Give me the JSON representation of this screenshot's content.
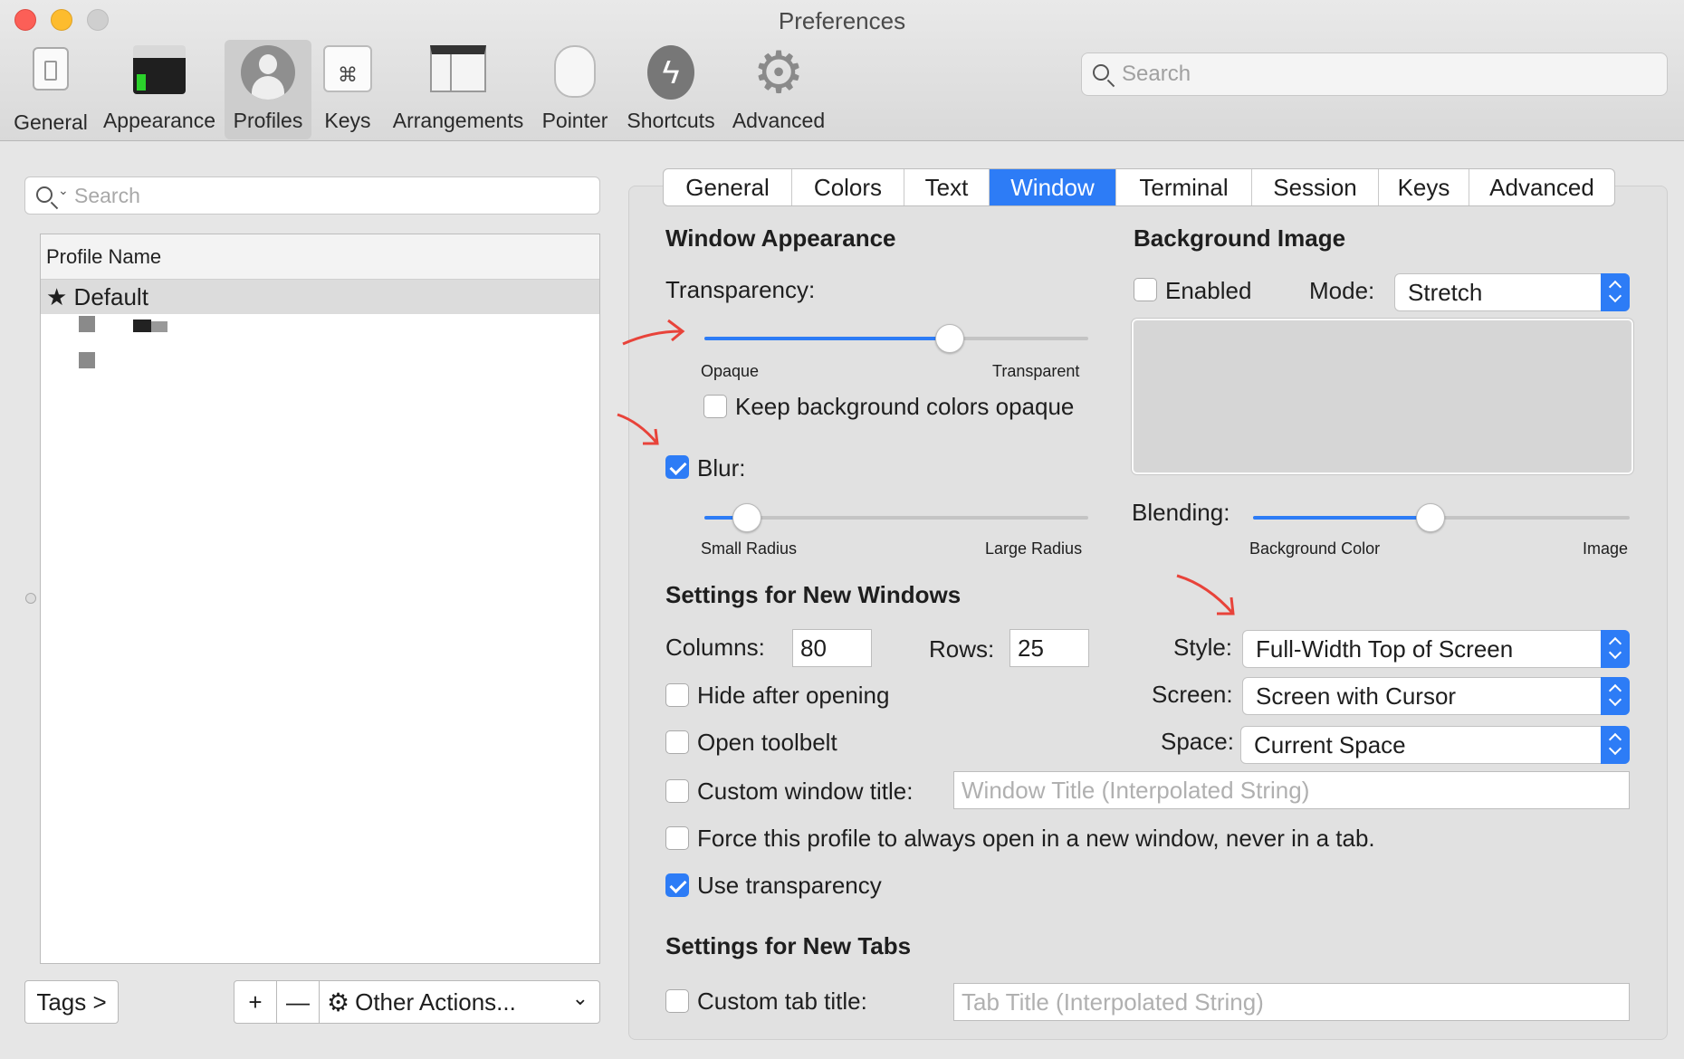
{
  "window": {
    "title": "Preferences"
  },
  "toolbar": {
    "items": [
      {
        "label": "General",
        "icon": "general-switch-icon"
      },
      {
        "label": "Appearance",
        "icon": "appearance-terminal-icon"
      },
      {
        "label": "Profiles",
        "icon": "profile-person-icon",
        "selected": true
      },
      {
        "label": "Keys",
        "icon": "command-key-icon"
      },
      {
        "label": "Arrangements",
        "icon": "arrangements-window-icon"
      },
      {
        "label": "Pointer",
        "icon": "mouse-pointer-icon"
      },
      {
        "label": "Shortcuts",
        "icon": "lightning-bolt-icon"
      },
      {
        "label": "Advanced",
        "icon": "gear-icon"
      }
    ],
    "search_placeholder": "Search"
  },
  "left_panel": {
    "search_placeholder": "Search",
    "column_header": "Profile Name",
    "default_profile": "Default",
    "tags_button": "Tags >",
    "add_symbol": "+",
    "remove_symbol": "—",
    "other_actions": "Other Actions..."
  },
  "tabs": {
    "items": [
      "General",
      "Colors",
      "Text",
      "Window",
      "Terminal",
      "Session",
      "Keys",
      "Advanced"
    ],
    "active": "Window"
  },
  "window_appearance": {
    "heading": "Window Appearance",
    "transparency_label": "Transparency:",
    "transparency_value": 0.64,
    "transparency_min_label": "Opaque",
    "transparency_max_label": "Transparent",
    "keep_bg_opaque_label": "Keep background colors opaque",
    "keep_bg_opaque_checked": false,
    "blur_label": "Blur:",
    "blur_checked": true,
    "blur_value": 0.11,
    "blur_min_label": "Small Radius",
    "blur_max_label": "Large Radius"
  },
  "background_image": {
    "heading": "Background Image",
    "enabled_label": "Enabled",
    "enabled_checked": false,
    "mode_label": "Mode:",
    "mode_value": "Stretch",
    "blending_label": "Blending:",
    "blending_value": 0.47,
    "blending_min_label": "Background Color",
    "blending_max_label": "Image"
  },
  "new_windows": {
    "heading": "Settings for New Windows",
    "columns_label": "Columns:",
    "columns_value": "80",
    "rows_label": "Rows:",
    "rows_value": "25",
    "style_label": "Style:",
    "style_value": "Full-Width Top of Screen",
    "screen_label": "Screen:",
    "screen_value": "Screen with Cursor",
    "space_label": "Space:",
    "space_value": "Current Space",
    "hide_after_opening_label": "Hide after opening",
    "hide_after_opening_checked": false,
    "open_toolbelt_label": "Open toolbelt",
    "open_toolbelt_checked": false,
    "custom_window_title_label": "Custom window title:",
    "custom_window_title_checked": false,
    "custom_window_title_placeholder": "Window Title (Interpolated String)",
    "force_new_window_label": "Force this profile to always open in a new window, never in a tab.",
    "force_new_window_checked": false,
    "use_transparency_label": "Use transparency",
    "use_transparency_checked": true
  },
  "new_tabs": {
    "heading": "Settings for New Tabs",
    "custom_tab_title_label": "Custom tab title:",
    "custom_tab_title_checked": false,
    "custom_tab_title_placeholder": "Tab Title (Interpolated String)"
  },
  "colors": {
    "accent": "#2d7cf6",
    "annotation": "#e8433a"
  }
}
